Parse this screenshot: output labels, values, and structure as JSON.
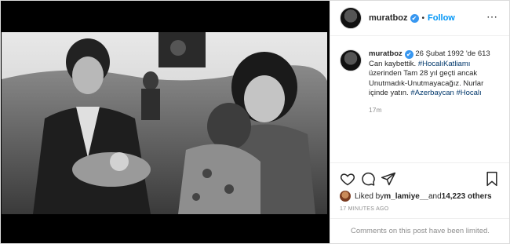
{
  "post": {
    "username": "muratboz",
    "verified_mark": "✔",
    "separator": "•",
    "follow_label": "Follow",
    "more_label": "⋯",
    "caption": {
      "username": "muratboz",
      "text_1": " 26 Şubat 1992 'de 613 Can kaybettik. ",
      "tag_1": "#HocalıKatliamı",
      "text_2": " üzerinden Tam 28 yıl geçti ancak Unutmadık-Unutmayacağız. Nurlar içinde yatın. ",
      "tag_2": "#Azerbaycan",
      "text_3": " ",
      "tag_3": "#Hocalı",
      "relative_time": "17m"
    },
    "likes": {
      "prefix": "Liked by ",
      "user": "m_lamiye__",
      "middle": " and ",
      "count": "14,223 others"
    },
    "time_ago": "17 MINUTES AGO",
    "comments_limited": "Comments on this post have been limited."
  },
  "icons": [
    "avatar",
    "verified-icon",
    "more-icon",
    "heart-icon",
    "comment-icon",
    "share-icon",
    "bookmark-icon"
  ],
  "colors": {
    "link": "#0095f6",
    "hashtag": "#00376b",
    "muted": "#8e8e8e",
    "verified": "#3897f0"
  }
}
